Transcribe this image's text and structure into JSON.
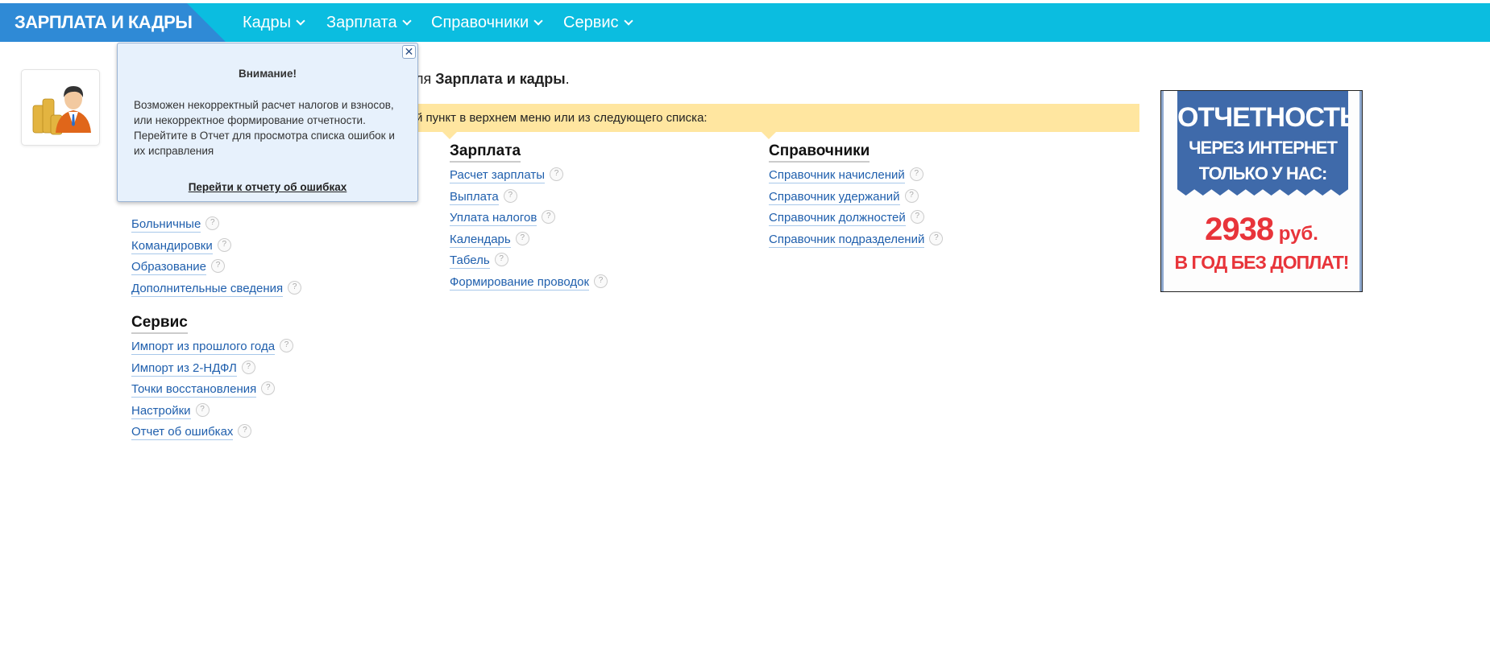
{
  "header": {
    "brand": "ЗАРПЛАТА И КАДРЫ",
    "nav": [
      {
        "label": "Кадры"
      },
      {
        "label": "Зарплата"
      },
      {
        "label": "Справочники"
      },
      {
        "label": "Сервис"
      }
    ]
  },
  "welcome": {
    "prefix": "ля ",
    "app": "Зарплата и кадры",
    "suffix": "."
  },
  "hint": "й пункт в верхнем меню или из следующего списка:",
  "kadry": {
    "items": [
      "Больничные",
      "Командировки",
      "Образование",
      "Дополнительные сведения"
    ]
  },
  "zarplata": {
    "title": "Зарплата",
    "items": [
      "Расчет зарплаты",
      "Выплата",
      "Уплата налогов",
      "Календарь",
      "Табель",
      "Формирование проводок"
    ]
  },
  "spravochniki": {
    "title": "Справочники",
    "items": [
      "Справочник начислений",
      "Справочник удержаний",
      "Справочник должностей",
      "Справочник подразделений"
    ]
  },
  "servis": {
    "title": "Сервис",
    "items": [
      "Импорт из прошлого года",
      "Импорт из 2-НДФЛ",
      "Точки восстановления",
      "Настройки",
      "Отчет об ошибках"
    ]
  },
  "help_glyph": "?",
  "popup": {
    "title": "Внимание!",
    "message": "Возможен некорректный расчет налогов и взносов, или некорректное формирование отчетности. Перейтите в Отчет для просмотра списка ошибок и их исправления",
    "link": "Перейти к отчету об ошибках",
    "close": "✕"
  },
  "ad": {
    "line1": "ОТЧЕТНОСТЬ",
    "line2": "ЧЕРЕЗ ИНТЕРНЕТ",
    "line3": "ТОЛЬКО У НАС:",
    "price": "2938",
    "currency": " руб.",
    "tagline": "В ГОД БЕЗ ДОПЛАТ!"
  },
  "colors": {
    "header": "#0bbde0",
    "brand": "#2f8ad6",
    "hint": "#ffe6a0",
    "link": "#1f5fad",
    "ad_blue": "#3f6aaa",
    "ad_red": "#e8343a"
  }
}
